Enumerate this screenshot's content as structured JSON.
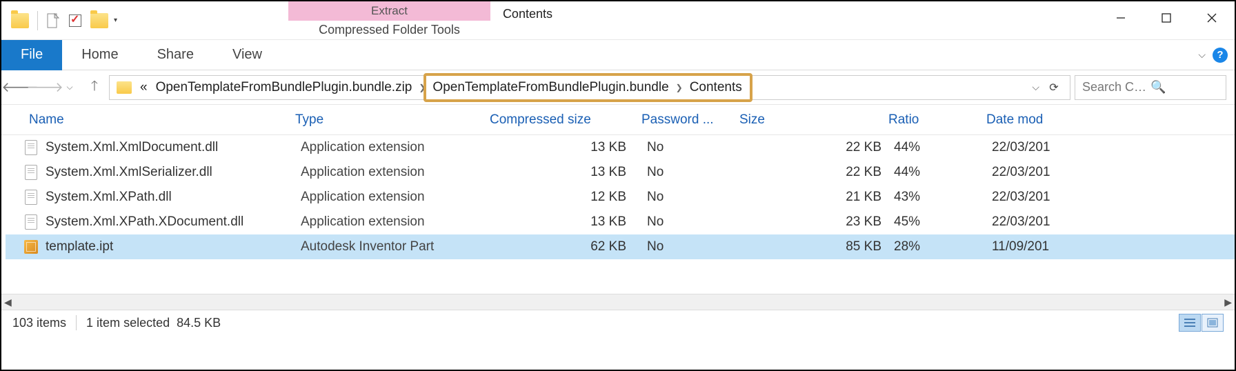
{
  "window": {
    "title": "Contents",
    "context_group": "Extract",
    "context_tab": "Compressed Folder Tools"
  },
  "ribbon": {
    "file": "File",
    "tabs": [
      "Home",
      "Share",
      "View"
    ]
  },
  "nav": {
    "breadcrumb_prefix": "«",
    "segments": [
      "OpenTemplateFromBundlePlugin.bundle.zip",
      "OpenTemplateFromBundlePlugin.bundle",
      "Contents"
    ],
    "highlighted_range": [
      1,
      2
    ],
    "search_placeholder": "Search Co..."
  },
  "columns": {
    "name": "Name",
    "type": "Type",
    "csize": "Compressed size",
    "pass": "Password ...",
    "size": "Size",
    "ratio": "Ratio",
    "date": "Date mod"
  },
  "files": [
    {
      "icon": "dll",
      "name": "System.Xml.XmlDocument.dll",
      "type": "Application extension",
      "csize": "13 KB",
      "pass": "No",
      "size": "22 KB",
      "ratio": "44%",
      "date": "22/03/201",
      "selected": false
    },
    {
      "icon": "dll",
      "name": "System.Xml.XmlSerializer.dll",
      "type": "Application extension",
      "csize": "13 KB",
      "pass": "No",
      "size": "22 KB",
      "ratio": "44%",
      "date": "22/03/201",
      "selected": false
    },
    {
      "icon": "dll",
      "name": "System.Xml.XPath.dll",
      "type": "Application extension",
      "csize": "12 KB",
      "pass": "No",
      "size": "21 KB",
      "ratio": "43%",
      "date": "22/03/201",
      "selected": false
    },
    {
      "icon": "dll",
      "name": "System.Xml.XPath.XDocument.dll",
      "type": "Application extension",
      "csize": "13 KB",
      "pass": "No",
      "size": "23 KB",
      "ratio": "45%",
      "date": "22/03/201",
      "selected": false
    },
    {
      "icon": "ipt",
      "name": "template.ipt",
      "type": "Autodesk Inventor Part",
      "csize": "62 KB",
      "pass": "No",
      "size": "85 KB",
      "ratio": "28%",
      "date": "11/09/201",
      "selected": true
    }
  ],
  "status": {
    "count": "103 items",
    "selection": "1 item selected",
    "sel_size": "84.5 KB"
  }
}
